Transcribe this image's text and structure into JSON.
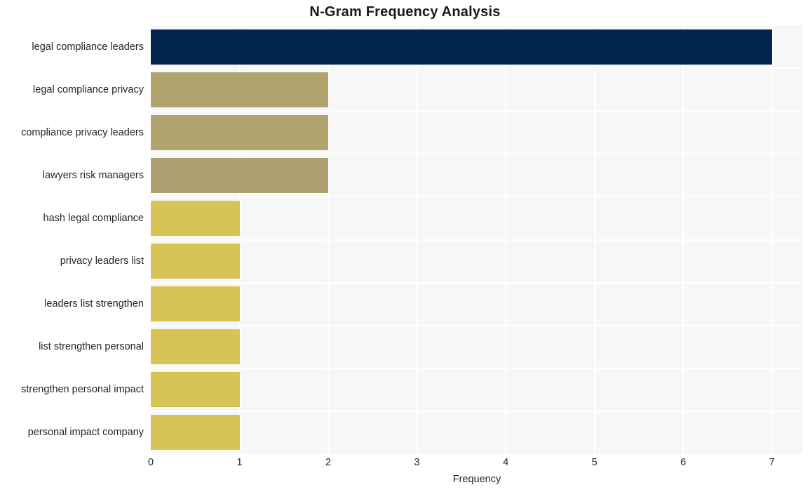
{
  "chart_data": {
    "type": "bar",
    "orientation": "horizontal",
    "title": "N-Gram Frequency Analysis",
    "xlabel": "Frequency",
    "ylabel": "",
    "categories": [
      "legal compliance leaders",
      "legal compliance privacy",
      "compliance privacy leaders",
      "lawyers risk managers",
      "hash legal compliance",
      "privacy leaders list",
      "leaders list strengthen",
      "list strengthen personal",
      "strengthen personal impact",
      "personal impact company"
    ],
    "values": [
      7,
      2,
      2,
      2,
      1,
      1,
      1,
      1,
      1,
      1
    ],
    "bar_colors": [
      "#042450",
      "#b0a36e",
      "#b0a36e",
      "#ada26f",
      "#d7c457",
      "#d7c457",
      "#d7c457",
      "#d7c457",
      "#d7c457",
      "#d7c457"
    ],
    "xlim": [
      0,
      7.35
    ],
    "x_ticks": [
      0,
      1,
      2,
      3,
      4,
      5,
      6,
      7
    ],
    "x_tick_labels": [
      "0",
      "1",
      "2",
      "3",
      "4",
      "5",
      "6",
      "7"
    ],
    "grid": true,
    "grid_color": "#ffffff",
    "plot_background": "#f7f7f7",
    "figure_background": "#ffffff",
    "legend": null,
    "text_color": "#262626"
  }
}
